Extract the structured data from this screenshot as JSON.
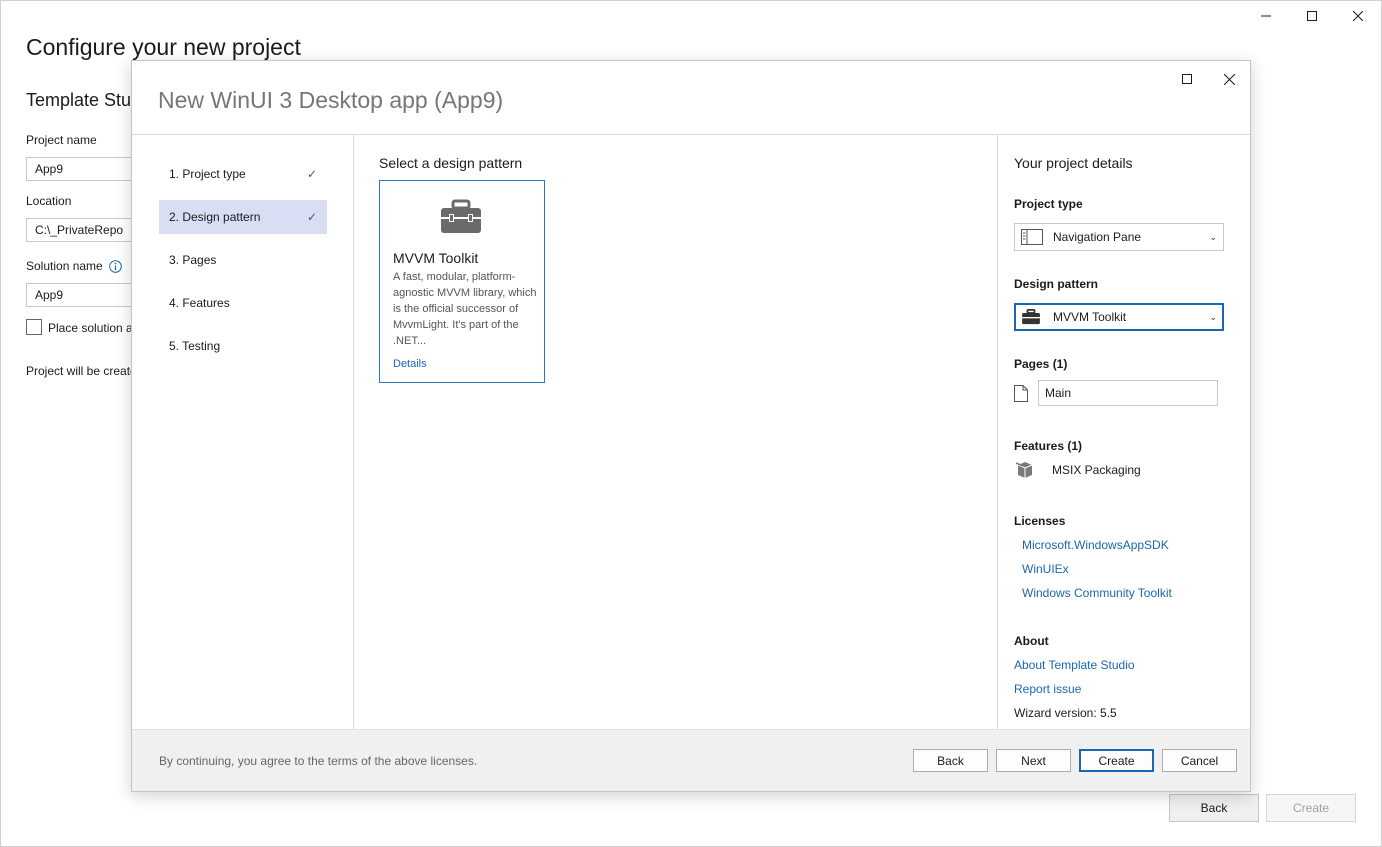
{
  "outer": {
    "title": "Configure your new project",
    "subtitle": "Template Stu",
    "project_name_label": "Project name",
    "project_name_value": "App9",
    "location_label": "Location",
    "location_value": "C:\\_PrivateRepo",
    "solution_name_label": "Solution name",
    "solution_name_value": "App9",
    "place_solution_label": "Place solution a",
    "project_created_text": "Project will be create",
    "back_label": "Back",
    "create_label": "Create"
  },
  "dialog": {
    "title": "New WinUI 3 Desktop app (App9)",
    "steps": [
      {
        "label": "1. Project type",
        "check": "✓"
      },
      {
        "label": "2. Design pattern",
        "check": "✓"
      },
      {
        "label": "3. Pages",
        "check": ""
      },
      {
        "label": "4. Features",
        "check": ""
      },
      {
        "label": "5. Testing",
        "check": ""
      }
    ],
    "center_heading": "Select a design pattern",
    "card": {
      "title": "MVVM Toolkit",
      "description": "A fast, modular, platform-agnostic MVVM library, which is the official successor of MvvmLight. It's part of the .NET...",
      "link": "Details",
      "icon": "toolbox-icon"
    },
    "details": {
      "heading": "Your project details",
      "project_type_label": "Project type",
      "project_type_value": "Navigation Pane",
      "design_pattern_label": "Design pattern",
      "design_pattern_value": "MVVM Toolkit",
      "pages_label": "Pages (1)",
      "page_value": "Main",
      "features_label": "Features (1)",
      "feature_value": "MSIX Packaging",
      "licenses_label": "Licenses",
      "licenses": [
        "Microsoft.WindowsAppSDK",
        "WinUIEx",
        "Windows Community Toolkit"
      ],
      "about_label": "About",
      "about_link": "About Template Studio",
      "report_link": "Report issue",
      "wizard_version": "Wizard version: 5.5"
    },
    "footer": {
      "note": "By continuing, you agree to the terms of the above licenses.",
      "back": "Back",
      "next": "Next",
      "create": "Create",
      "cancel": "Cancel"
    }
  },
  "colors": {
    "accent": "#1a66b3",
    "active_step_bg": "#d9def5",
    "footer_bg": "#f0f0f0"
  }
}
